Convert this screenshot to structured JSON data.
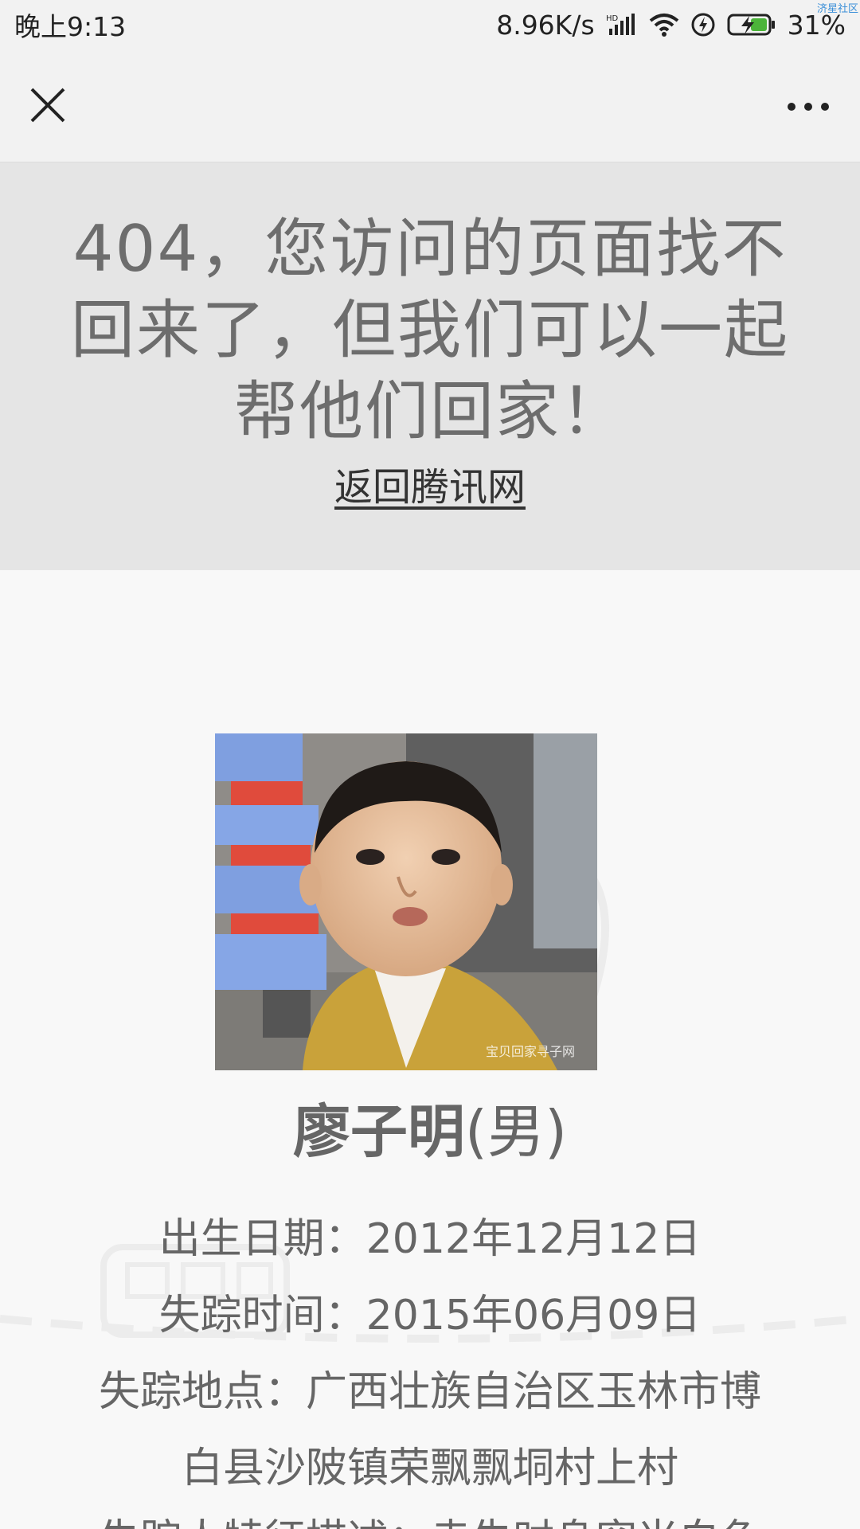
{
  "status_bar": {
    "time": "晚上9:13",
    "network_speed": "8.96K/s",
    "battery": "31%",
    "corner_watermark": "济星社区",
    "icons": [
      "hd-signal-icon",
      "wifi-icon",
      "data-saver-icon",
      "battery-charging-icon"
    ]
  },
  "nav": {
    "close_icon": "close-icon",
    "more_icon": "more-icon"
  },
  "banner": {
    "title": "404，您访问的页面找不回来了，但我们可以一起帮他们回家！",
    "link": "返回腾讯网"
  },
  "person": {
    "name": "廖子明",
    "gender": "(男)",
    "photo_watermark": "宝贝回家寻子网",
    "lines": [
      "出生日期：2012年12月12日",
      "失踪时间：2015年06月09日",
      "失踪地点：广西壮族自治区玉林市博",
      "白县沙陂镇荣飘飘垌村上村",
      "失踪人特征描述：走失时身穿米白色"
    ]
  },
  "colors": {
    "banner_bg": "#e5e5e5",
    "page_bg": "#f8f8f8",
    "text": "#666666",
    "battery_green": "#4cb43a"
  }
}
